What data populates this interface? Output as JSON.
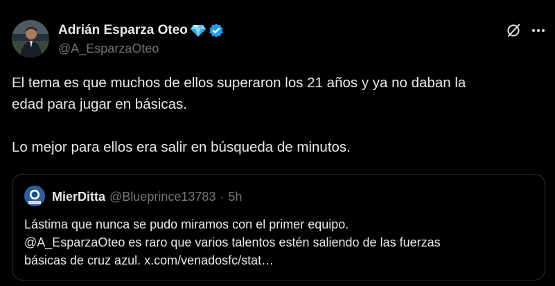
{
  "author": {
    "display_name": "Adrián Esparza Oteo",
    "handle": "@A_EsparzaOteo",
    "badge_emoji_icon": "gem-icon",
    "verified_icon": "verified-badge-icon"
  },
  "actions": {
    "grok_icon": "grok-icon",
    "more_icon": "more-icon"
  },
  "tweet": {
    "lines": [
      "El tema es que muchos de ellos superaron los 21 años y ya no daban la",
      "edad para jugar en básicas.",
      "Lo mejor para ellos era salir en búsqueda de minutos."
    ]
  },
  "quote": {
    "display_name": "MierDitta",
    "handle": "@Blueprince13783",
    "separator": "·",
    "time": "5h",
    "lines": [
      "Lástima que nunca se pudo miramos con el primer equipo.",
      "@A_EsparzaOteo  es raro que varios talentos estén saliendo de las fuerzas",
      "básicas de cruz azul. x.com/venadosfc/stat…"
    ]
  },
  "colors": {
    "background": "#000000",
    "text": "#e7e9ea",
    "secondary": "#71767b",
    "verified": "#1d9bf0",
    "border": "#2f3336"
  }
}
